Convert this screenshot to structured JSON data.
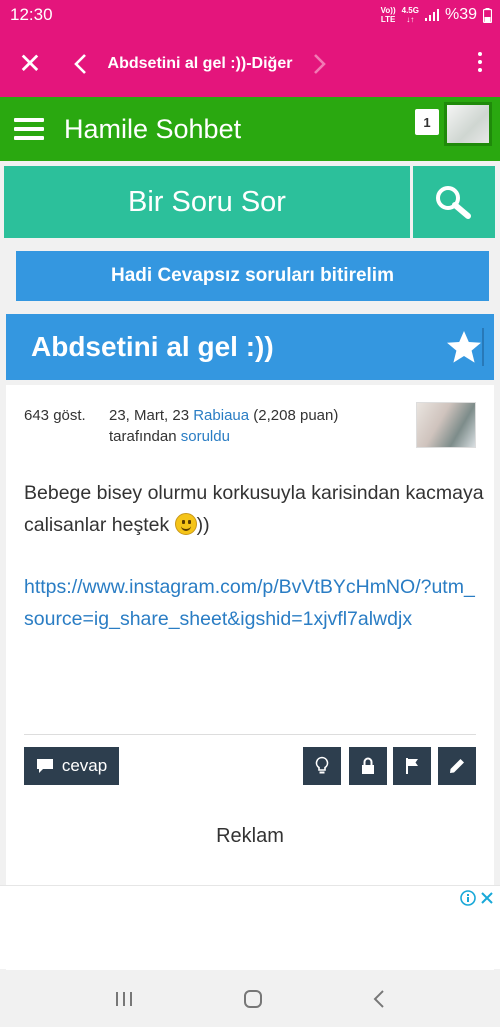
{
  "status_bar": {
    "time": "12:30",
    "net_top": "Vo))",
    "net_bottom": "LTE",
    "net_type": "4.5G",
    "battery": "%39"
  },
  "app_bar": {
    "title": "Abdsetini al gel :))-Diğer"
  },
  "site": {
    "title": "Hamile Sohbet",
    "notification_count": "1"
  },
  "ask": {
    "label": "Bir Soru Sor"
  },
  "cta": {
    "label": "Hadi Cevapsız soruları bitirelim"
  },
  "question": {
    "title": "Abdsetini al gel :))",
    "views": "643 göst.",
    "date": "23, Mart, 23",
    "author": "Rabiaua",
    "points": "(2,208 puan)",
    "by": "tarafından",
    "action": "soruldu",
    "body": "Bebege bisey olurmu korkusuyla karisindan kacmaya  calisanlar heştek",
    "body_end": "))",
    "link": "https://www.instagram.com/p/BvVtBYcHmNO/?utm_source=ig_share_sheet&igshid=1xjvfl7alwdjx"
  },
  "actions": {
    "answer": "cevap"
  },
  "ad": {
    "label": "Reklam"
  },
  "colors": {
    "status_app_bar": "#e4157c",
    "site_header": "#2aa810",
    "ask_bar": "#2cc09b",
    "accent_blue": "#3497e0",
    "buttons_dark": "#2d3e4e",
    "link": "#2a7dc4"
  }
}
